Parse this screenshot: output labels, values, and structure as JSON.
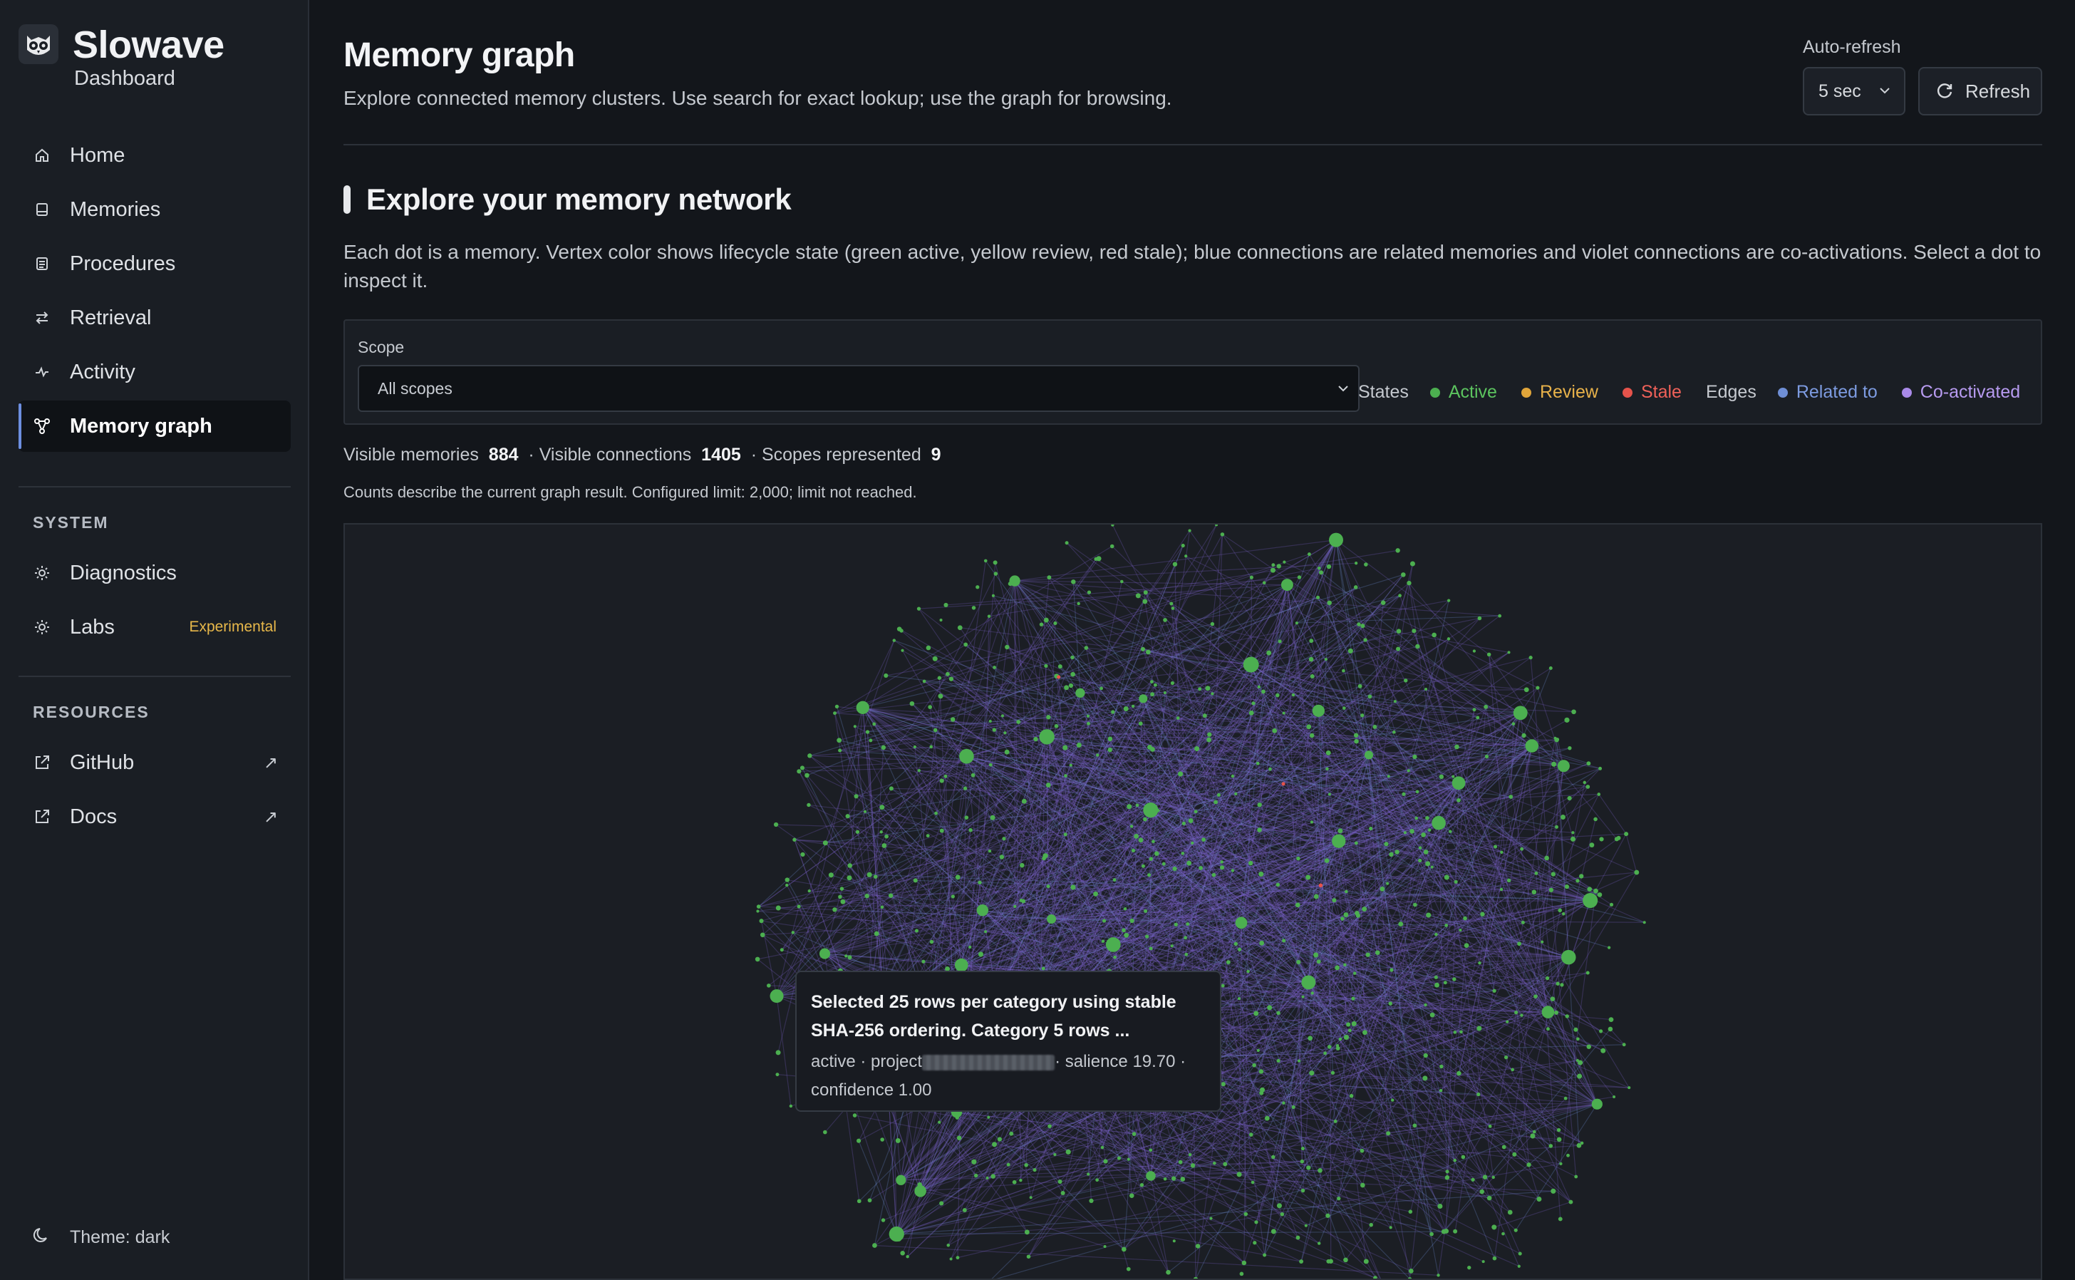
{
  "app": {
    "name": "Slowave",
    "subtitle": "Dashboard"
  },
  "sidebar": {
    "nav": [
      {
        "label": "Home",
        "icon": "home-icon"
      },
      {
        "label": "Memories",
        "icon": "memories-icon"
      },
      {
        "label": "Procedures",
        "icon": "procedures-icon"
      },
      {
        "label": "Retrieval",
        "icon": "retrieval-icon"
      },
      {
        "label": "Activity",
        "icon": "activity-icon"
      },
      {
        "label": "Memory graph",
        "icon": "graph-icon",
        "active": true
      }
    ],
    "system_label": "SYSTEM",
    "system": [
      {
        "label": "Diagnostics",
        "icon": "gear-icon"
      },
      {
        "label": "Labs",
        "icon": "gear-icon",
        "badge": "Experimental"
      }
    ],
    "resources_label": "RESOURCES",
    "resources": [
      {
        "label": "GitHub",
        "icon": "external-link-icon"
      },
      {
        "label": "Docs",
        "icon": "external-link-icon"
      }
    ],
    "theme": "Theme: dark"
  },
  "header": {
    "title": "Memory graph",
    "subtitle": "Explore connected memory clusters. Use search for exact lookup; use the graph for browsing.",
    "auto_refresh_label": "Auto-refresh",
    "auto_refresh_value": "5 sec",
    "refresh_label": "Refresh"
  },
  "section": {
    "title": "Explore your memory network",
    "description": "Each dot is a memory. Vertex color shows lifecycle state (green active, yellow review, red stale); blue connections are related memories and violet connections are co-activations. Select a dot to inspect it."
  },
  "filters": {
    "scope_label": "Scope",
    "scope_value": "All scopes",
    "states_label": "States",
    "states": [
      {
        "label": "Active",
        "color": "#4caf50"
      },
      {
        "label": "Review",
        "color": "#e0a53a"
      },
      {
        "label": "Stale",
        "color": "#e5534b"
      }
    ],
    "edges_label": "Edges",
    "edges": [
      {
        "label": "Related to",
        "color": "#6f8fd6"
      },
      {
        "label": "Co-activated",
        "color": "#a98ae8"
      }
    ]
  },
  "stats": {
    "visible_memories_label": "Visible memories",
    "visible_memories": "884",
    "visible_connections_label": "· Visible connections",
    "visible_connections": "1405",
    "scopes_label": "· Scopes represented",
    "scopes": "9",
    "note": "Counts describe the current graph result. Configured limit: 2,000; limit not reached."
  },
  "tooltip": {
    "title_line1": "Selected 25 rows per category using stable",
    "title_line2": "SHA-256 ordering. Category 5 rows ...",
    "meta_prefix": "active · project",
    "meta_suffix": "· salience 19.70 ·",
    "meta_line2": "confidence 1.00"
  },
  "colors": {
    "accent": "#6d8fe0",
    "node": "#4caf50",
    "edge": "#7a62c9",
    "stale": "#e5534b"
  }
}
